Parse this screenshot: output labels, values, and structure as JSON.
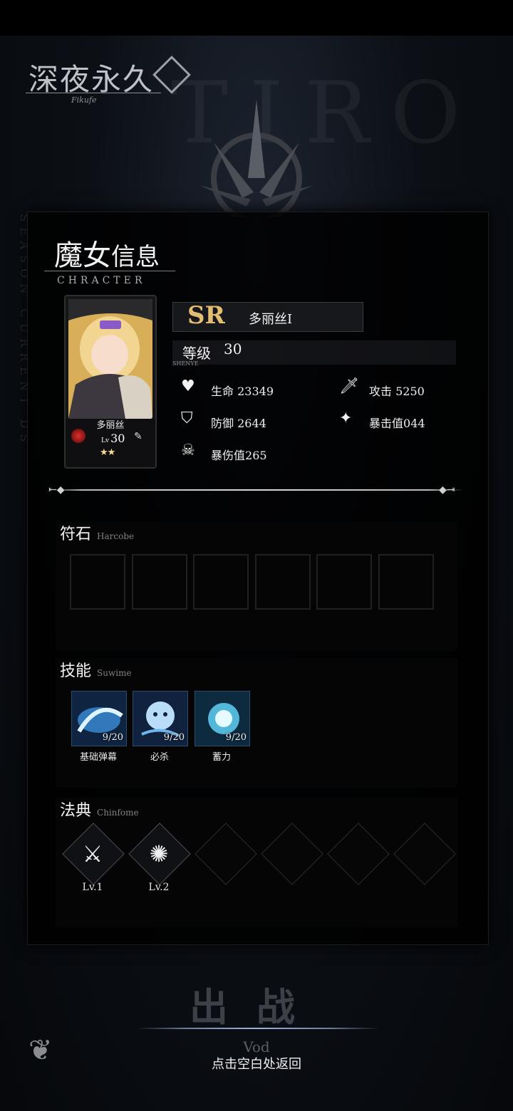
{
  "app": {
    "logo_title": "深夜永久",
    "logo_sub": "Fikufe"
  },
  "panel": {
    "title_a": "魔女",
    "title_b": "信息",
    "subtitle": "CHRACTER"
  },
  "card": {
    "name": "多丽丝",
    "lv_prefix": "Lv",
    "level": "30",
    "stars": "★★"
  },
  "hero": {
    "rarity": "SR",
    "name": "多丽丝I",
    "level_label": "等级",
    "level_value": "30",
    "level_sub": "SHENYE"
  },
  "stats": [
    {
      "label": "生命",
      "value": "23349",
      "icon": "heart-icon"
    },
    {
      "label": "攻击",
      "value": "5250",
      "icon": "sword-icon"
    },
    {
      "label": "防御",
      "value": "2644",
      "icon": "shield-icon"
    },
    {
      "label": "暴击值",
      "value": "044",
      "icon": "crit-icon"
    },
    {
      "label": "暴伤值",
      "value": "265",
      "icon": "skull-icon"
    }
  ],
  "runes": {
    "title": "符石",
    "en": "Harcobe"
  },
  "skills": {
    "title": "技能",
    "en": "Suwime",
    "items": [
      {
        "name": "基础弹幕",
        "count": "9/20"
      },
      {
        "name": "必杀",
        "count": "9/20"
      },
      {
        "name": "蓄力",
        "count": "9/20"
      }
    ]
  },
  "codex": {
    "title": "法典",
    "en": "Chinfome",
    "items": [
      {
        "level": "Lv.1",
        "icon": "crossed-blades-icon"
      },
      {
        "level": "Lv.2",
        "icon": "spider-icon"
      }
    ]
  },
  "footer": {
    "sortie": "出战",
    "vod": "Vod",
    "back_hint": "点击空白处返回"
  }
}
